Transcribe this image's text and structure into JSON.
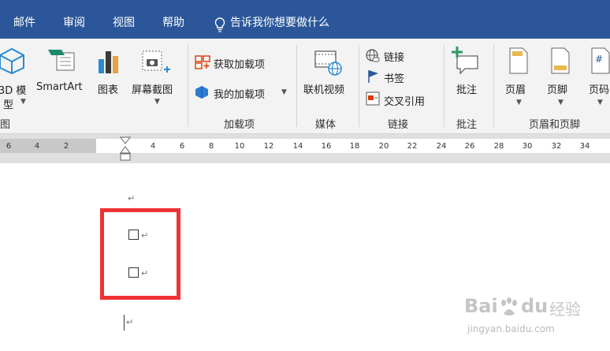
{
  "ribbon_tabs": [
    "邮件",
    "审阅",
    "视图",
    "帮助"
  ],
  "tell_me": "告诉我你想要做什么",
  "groups": {
    "illustrations": {
      "model3d_a": "3D 模",
      "model3d_b": "型",
      "smartart": "SmartArt",
      "chart": "图表",
      "screenshot": "屏幕截图",
      "name": "图"
    },
    "addins": {
      "get": "获取加载项",
      "my": "我的加载项",
      "name": "加载项"
    },
    "media": {
      "online_video": "联机视频",
      "name": "媒体"
    },
    "links": {
      "link": "链接",
      "bookmark": "书签",
      "crossref": "交叉引用",
      "name": "链接"
    },
    "comments": {
      "comment": "批注",
      "name": "批注"
    },
    "header_footer": {
      "header": "页眉",
      "footer": "页脚",
      "page_number": "页码",
      "name": "页眉和页脚"
    }
  },
  "ruler": {
    "left_ticks": [
      "6",
      "4",
      "2"
    ],
    "right_ticks": [
      "4",
      "6",
      "8",
      "10",
      "12",
      "14",
      "16",
      "18",
      "20",
      "22",
      "24",
      "26",
      "28",
      "30",
      "32",
      "34"
    ]
  },
  "document": {
    "paragraph_mark": "↵"
  },
  "watermark": {
    "brand": "Bai",
    "brand2": "du",
    "jingyan": "经验",
    "url": "jingyan.baidu.com"
  },
  "colors": {
    "ribbon_bar": "#2b579a",
    "highlight": "#ef3335"
  }
}
